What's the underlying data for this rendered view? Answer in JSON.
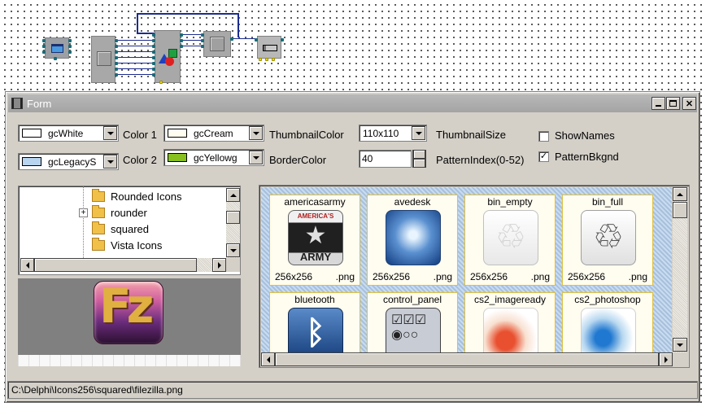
{
  "window": {
    "title": "Form"
  },
  "controls": {
    "color1": {
      "value": "gcWhite",
      "swatch": "#ffffff",
      "label": "Color 1"
    },
    "color2": {
      "value": "gcLegacyS",
      "swatch": "#b8d4ee",
      "label": "Color 2"
    },
    "thumbnail_color": {
      "value": "gcCream",
      "swatch": "#fffcf0",
      "label": "ThumbnailColor"
    },
    "border_color": {
      "value": "gcYellowg",
      "swatch": "#88c020",
      "label": "BorderColor"
    },
    "thumbnail_size": {
      "value": "110x110",
      "label": "ThumbnailSize"
    },
    "pattern_index": {
      "value": "40",
      "label": "PatternIndex(0-52)"
    },
    "show_names": {
      "label": "ShowNames",
      "checked": false,
      "mark": ""
    },
    "pattern_bkgnd": {
      "label": "PatternBkgnd",
      "checked": true,
      "mark": "✓"
    }
  },
  "tree": {
    "items": [
      {
        "label": "Rounded Icons",
        "expander": ""
      },
      {
        "label": "rounder",
        "expander": "+"
      },
      {
        "label": "squared",
        "expander": ""
      },
      {
        "label": "Vista Icons",
        "expander": ""
      }
    ]
  },
  "preview": {
    "icon": "filezilla-icon",
    "letters": "Fz"
  },
  "thumbnails": [
    {
      "name": "americasarmy",
      "size": "256x256",
      "ext": ".png",
      "icon": "americasarmy-icon",
      "caption_top": "AMERICA'S",
      "caption_bottom": "ARMY"
    },
    {
      "name": "avedesk",
      "size": "256x256",
      "ext": ".png",
      "icon": "avedesk-icon"
    },
    {
      "name": "bin_empty",
      "size": "256x256",
      "ext": ".png",
      "icon": "recycle-bin-empty-icon"
    },
    {
      "name": "bin_full",
      "size": "256x256",
      "ext": ".png",
      "icon": "recycle-bin-full-icon"
    },
    {
      "name": "bluetooth",
      "icon": "bluetooth-icon"
    },
    {
      "name": "control_panel",
      "icon": "control-panel-icon"
    },
    {
      "name": "cs2_imageready",
      "icon": "imageready-icon"
    },
    {
      "name": "cs2_photoshop",
      "icon": "photoshop-icon"
    }
  ],
  "status": {
    "path": "C:\\Delphi\\Icons256\\squared\\filezilla.png"
  },
  "colors": {
    "wire": "#1c2c8c",
    "pin": "#1a6b78",
    "thumb_border": "#e0c040"
  }
}
